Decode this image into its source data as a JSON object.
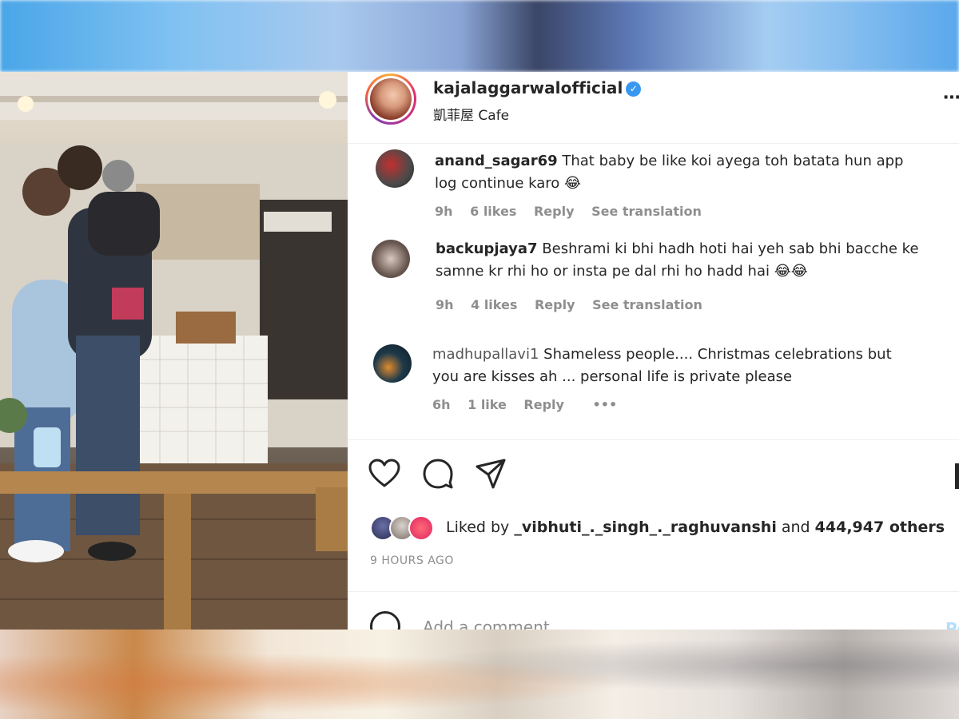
{
  "post": {
    "username": "kajalaggarwalofficial",
    "verified_icon": "verified-badge-icon",
    "location": "凱菲屋 Cafe",
    "more_icon": "more-options-icon"
  },
  "comments": [
    {
      "username": "anand_sagar69",
      "text": "That baby be like koi ayega toh batata hun app log continue karo 😂",
      "time": "9h",
      "likes": "6 likes",
      "reply": "Reply",
      "translate": "See translation"
    },
    {
      "username": "backupjaya7",
      "text": "Beshrami ki bhi hadh hoti hai yeh sab bhi bacche ke samne kr rhi ho or insta pe dal rhi ho hadd hai 😂😂",
      "time": "9h",
      "likes": "4 likes",
      "reply": "Reply",
      "translate": "See translation"
    },
    {
      "username": "madhupallavi1",
      "text": "Shameless people.... Christmas celebrations but you are kisses ah ... personal life is private please",
      "time": "6h",
      "likes": "1 like",
      "reply": "Reply",
      "more": "•••"
    }
  ],
  "actions": {
    "like_icon": "heart-icon",
    "comment_icon": "comment-bubble-icon",
    "share_icon": "send-paper-plane-icon",
    "save_icon": "bookmark-icon"
  },
  "likes": {
    "prefix": "Liked by",
    "user": "_vibhuti_._singh_._raghuvanshi",
    "and": "and",
    "count": "444,947 others"
  },
  "timeago": "9 HOURS AGO",
  "add_comment": {
    "placeholder": "Add a comment...",
    "post_label": "Po",
    "emoji_icon": "emoji-smiley-icon"
  },
  "colors": {
    "text": "#262626",
    "muted": "#8e8e8e",
    "verified": "#3897f0",
    "post_button": "#b2dffc"
  }
}
